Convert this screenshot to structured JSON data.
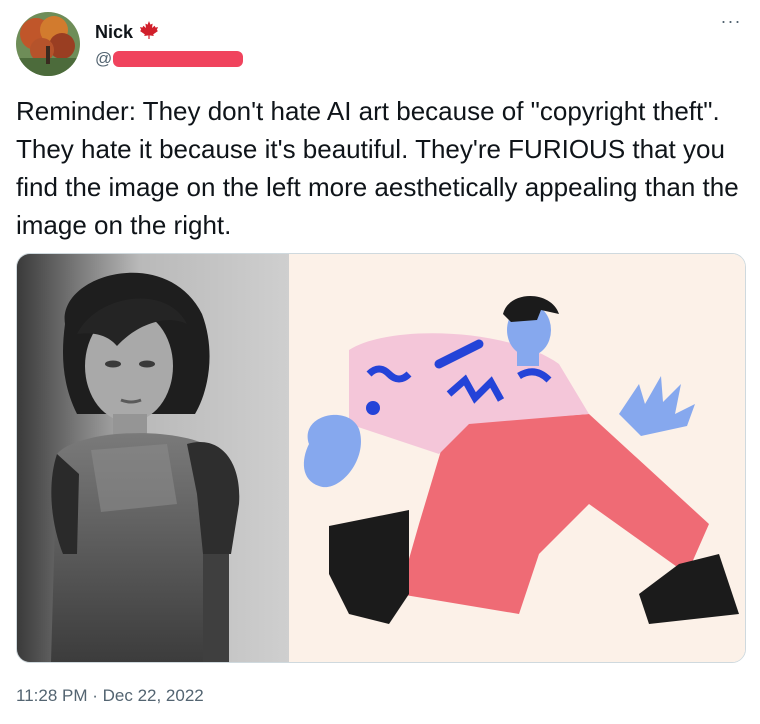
{
  "author": {
    "name": "Nick",
    "flag_icon": "maple-leaf-icon",
    "handle_prefix": "@"
  },
  "tweet": {
    "text": "Reminder: They don't hate AI art because of \"copyright theft\". They hate it because it's beautiful. They're FURIOUS that you find the image on the left more aesthetically appealing than the image on the right.",
    "more_icon": "more-options-icon",
    "more_label": "···"
  },
  "media": {
    "left_image": "ai-portrait-woman-armor",
    "right_image": "flat-illustration-running-man"
  },
  "meta": {
    "timestamp": "11:28 PM · Dec 22, 2022"
  },
  "colors": {
    "redaction": "#f0435d",
    "leaf": "#d11f2b",
    "secondary_text": "#536471"
  }
}
